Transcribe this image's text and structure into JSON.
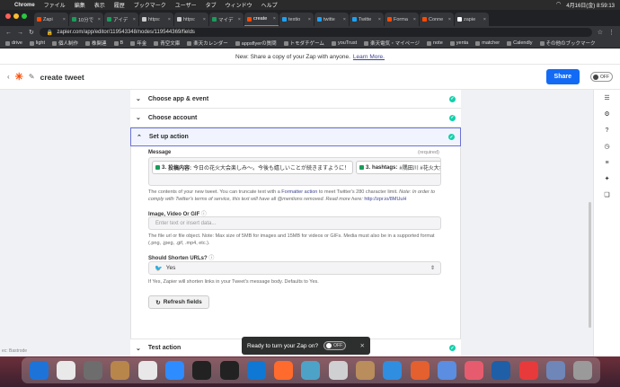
{
  "menubar": {
    "app": "Chrome",
    "items": [
      "ファイル",
      "編集",
      "表示",
      "履歴",
      "ブックマーク",
      "ユーザー",
      "タブ",
      "ウィンドウ",
      "ヘルプ"
    ],
    "clock": "4月16日(金) 8:59:13"
  },
  "tabs": [
    {
      "label": "Zapi",
      "color": "#ff4a00"
    },
    {
      "label": "10分で",
      "color": "#1a9c5b"
    },
    {
      "label": "アイデ",
      "color": "#1a9c5b"
    },
    {
      "label": "https:",
      "color": "#cccccc"
    },
    {
      "label": "https:",
      "color": "#cccccc"
    },
    {
      "label": "マイデ",
      "color": "#1a9c5b"
    },
    {
      "label": "create",
      "color": "#ff4a00",
      "active": true
    },
    {
      "label": "textio",
      "color": "#1da1f2"
    },
    {
      "label": "twitte",
      "color": "#1da1f2"
    },
    {
      "label": "Twitte",
      "color": "#1da1f2"
    },
    {
      "label": "Forma",
      "color": "#ff4a00"
    },
    {
      "label": "Conne",
      "color": "#ff4a00"
    },
    {
      "label": "zapie",
      "color": "#ffffff"
    }
  ],
  "address": {
    "url": "zapier.com/app/editor/119543348/nodes/119544369/fields"
  },
  "bookmarks": [
    "drive",
    "light",
    "個人制作",
    "株関連",
    "B",
    "年金",
    "青空文庫",
    "楽天カレンダー",
    "appsflyerの質問",
    "トモダチゲーム",
    "youTrust",
    "楽天電気・マイページ",
    "note",
    "yenta",
    "matcher",
    "Calendly",
    "その他のブックマーク"
  ],
  "banner": {
    "text": "New: Share a copy of your Zap with anyone.",
    "link": "Learn More."
  },
  "header": {
    "title": "create tweet",
    "share": "Share",
    "toggle": "OFF"
  },
  "steps": {
    "choose_app": "Choose app & event",
    "choose_account": "Choose account",
    "set_up": "Set up action",
    "test": "Test action"
  },
  "message": {
    "label": "Message",
    "required": "(required)",
    "pill1_num": "3.",
    "pill1_key": "投稿内容:",
    "pill1_val": "今日の花火大会楽しみ〜。今後も嬉しいことが続きますように！",
    "pill2_num": "3.",
    "pill2_key": "hashtags:",
    "pill2_val": "#隅田川 #花火大会",
    "help_prefix": "The contents of your new tweet. You can truncate text with a",
    "help_link": "Formatter action",
    "help_suffix": "to meet Twitter's 280 character limit.",
    "help_note": "Note: In order to comply with Twitter's terms of service, this text will have all @mentions removed. Read more here:",
    "help_url": "http://zpr.io/8MUuH"
  },
  "image": {
    "label": "Image, Video Or GIF",
    "placeholder": "Enter text or insert data...",
    "help": "The file url or file object. Note: Max size of 5MB for images and 15MB for videos or GIFs. Media must also be in a supported format (.png, .jpeg, .gif, .mp4, etc.)."
  },
  "shorten": {
    "label": "Should Shorten URLs?",
    "value": "Yes",
    "help": "If Yes, Zapier will shorten links in your Tweet's message body. Defaults to Yes."
  },
  "refresh": "Refresh fields",
  "toast": {
    "text": "Ready to turn your Zap on?",
    "toggle": "OFF"
  },
  "corner": "ec: Bastrode",
  "dock_colors": [
    "#1e73d8",
    "#e9e9e9",
    "#6d6d6d",
    "#b8864b",
    "#e8e8e8",
    "#2d8cff",
    "#222",
    "#222",
    "#0f78d4",
    "#ff6b2c",
    "#4da3c7",
    "#cfd0d2",
    "#b98d5c",
    "#2f8ee0",
    "#e4602f",
    "#5b8de0",
    "#e65c6e",
    "#1e5fa8",
    "#e83a3a",
    "#6f86b8",
    "#9a9a9a"
  ]
}
